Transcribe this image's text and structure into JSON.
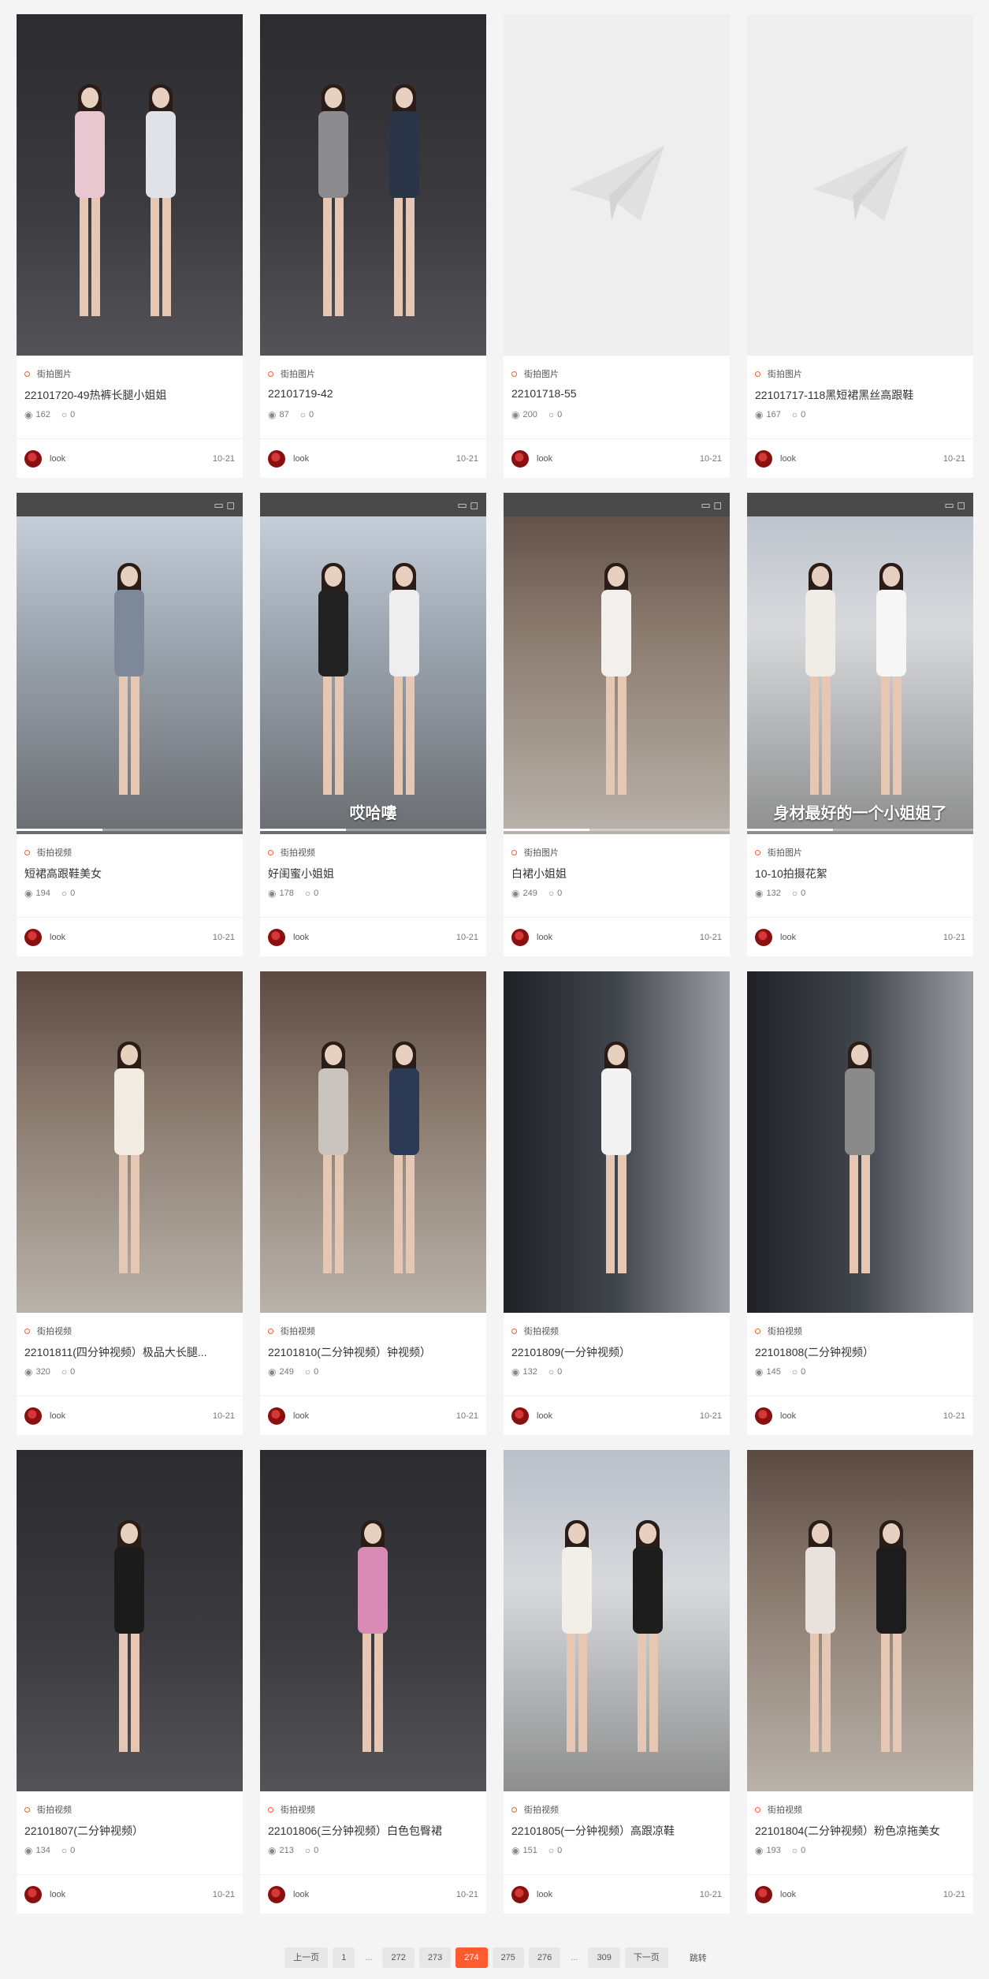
{
  "accent_color": "#ff5b2e",
  "cards": [
    {
      "category": "街拍图片",
      "title": "22101720-49热裤长腿小姐姐",
      "views": "162",
      "comments": "0",
      "author": "look",
      "date": "10-21",
      "thumb": "photo",
      "scene": "night",
      "colors": [
        "#e8c7d0",
        "#dfe3e8"
      ]
    },
    {
      "category": "街拍图片",
      "title": "22101719-42",
      "views": "87",
      "comments": "0",
      "author": "look",
      "date": "10-21",
      "thumb": "photo",
      "scene": "night",
      "colors": [
        "#8c8c90",
        "#2b3548"
      ]
    },
    {
      "category": "街拍图片",
      "title": "22101718-55",
      "views": "200",
      "comments": "0",
      "author": "look",
      "date": "10-21",
      "thumb": "placeholder",
      "scene": "",
      "colors": []
    },
    {
      "category": "街拍图片",
      "title": "22101717-118黑短裙黑丝高跟鞋",
      "views": "167",
      "comments": "0",
      "author": "look",
      "date": "10-21",
      "thumb": "placeholder",
      "scene": "",
      "colors": []
    },
    {
      "category": "街拍视频",
      "title": "短裙高跟鞋美女",
      "views": "194",
      "comments": "0",
      "author": "look",
      "date": "10-21",
      "thumb": "video",
      "scene": "street",
      "caption": "",
      "colors": [
        "#7d8899"
      ]
    },
    {
      "category": "街拍视频",
      "title": "好闺蜜小姐姐",
      "views": "178",
      "comments": "0",
      "author": "look",
      "date": "10-21",
      "thumb": "video",
      "scene": "street",
      "caption": "哎哈嘍",
      "colors": [
        "#222",
        "#eee"
      ]
    },
    {
      "category": "街拍图片",
      "title": "白裙小姐姐",
      "views": "249",
      "comments": "0",
      "author": "look",
      "date": "10-21",
      "thumb": "video",
      "scene": "mall",
      "caption": "",
      "colors": [
        "#f2f0ec"
      ]
    },
    {
      "category": "街拍图片",
      "title": "10-10拍摄花絮",
      "views": "132",
      "comments": "0",
      "author": "look",
      "date": "10-21",
      "thumb": "video",
      "scene": "plaza",
      "caption": "身材最好的一个小姐姐了",
      "colors": [
        "#f0ede6",
        "#f6f6f6"
      ]
    },
    {
      "category": "街拍视频",
      "title": "22101811(四分钟视频）极品大长腿...",
      "views": "320",
      "comments": "0",
      "author": "look",
      "date": "10-21",
      "thumb": "photo",
      "scene": "mall",
      "colors": [
        "#f1ebe1"
      ]
    },
    {
      "category": "街拍视频",
      "title": "22101810(二分钟视频）钟视频）",
      "views": "249",
      "comments": "0",
      "author": "look",
      "date": "10-21",
      "thumb": "photo",
      "scene": "mall",
      "colors": [
        "#c9c4bd",
        "#2c3a55"
      ]
    },
    {
      "category": "街拍视频",
      "title": "22101809(一分钟视频）",
      "views": "132",
      "comments": "0",
      "author": "look",
      "date": "10-21",
      "thumb": "photo",
      "scene": "store",
      "colors": [
        "#f2f2f2"
      ]
    },
    {
      "category": "街拍视频",
      "title": "22101808(二分钟视频）",
      "views": "145",
      "comments": "0",
      "author": "look",
      "date": "10-21",
      "thumb": "photo",
      "scene": "store",
      "colors": [
        "#8a8a8a"
      ]
    },
    {
      "category": "街拍视频",
      "title": "22101807(二分钟视频）",
      "views": "134",
      "comments": "0",
      "author": "look",
      "date": "10-21",
      "thumb": "photo",
      "scene": "night",
      "colors": [
        "#1b1b1b"
      ]
    },
    {
      "category": "街拍视频",
      "title": "22101806(三分钟视频）白色包臀裙",
      "views": "213",
      "comments": "0",
      "author": "look",
      "date": "10-21",
      "thumb": "photo",
      "scene": "night",
      "colors": [
        "#d98bb5"
      ]
    },
    {
      "category": "街拍视频",
      "title": "22101805(一分钟视频）高跟凉鞋",
      "views": "151",
      "comments": "0",
      "author": "look",
      "date": "10-21",
      "thumb": "photo",
      "scene": "plaza",
      "colors": [
        "#f1efe8",
        "#1d1d1d"
      ]
    },
    {
      "category": "街拍视频",
      "title": "22101804(二分钟视频）粉色凉拖美女",
      "views": "193",
      "comments": "0",
      "author": "look",
      "date": "10-21",
      "thumb": "photo",
      "scene": "mall",
      "colors": [
        "#e9e2dc",
        "#1c1c1c"
      ]
    }
  ],
  "pagination": {
    "prev": "上一页",
    "pages_left": [
      "1"
    ],
    "ellipsis": "...",
    "pages_mid": [
      "272",
      "273"
    ],
    "current": "274",
    "pages_after": [
      "275",
      "276"
    ],
    "last": "309",
    "next": "下一页",
    "jump": "跳转"
  }
}
